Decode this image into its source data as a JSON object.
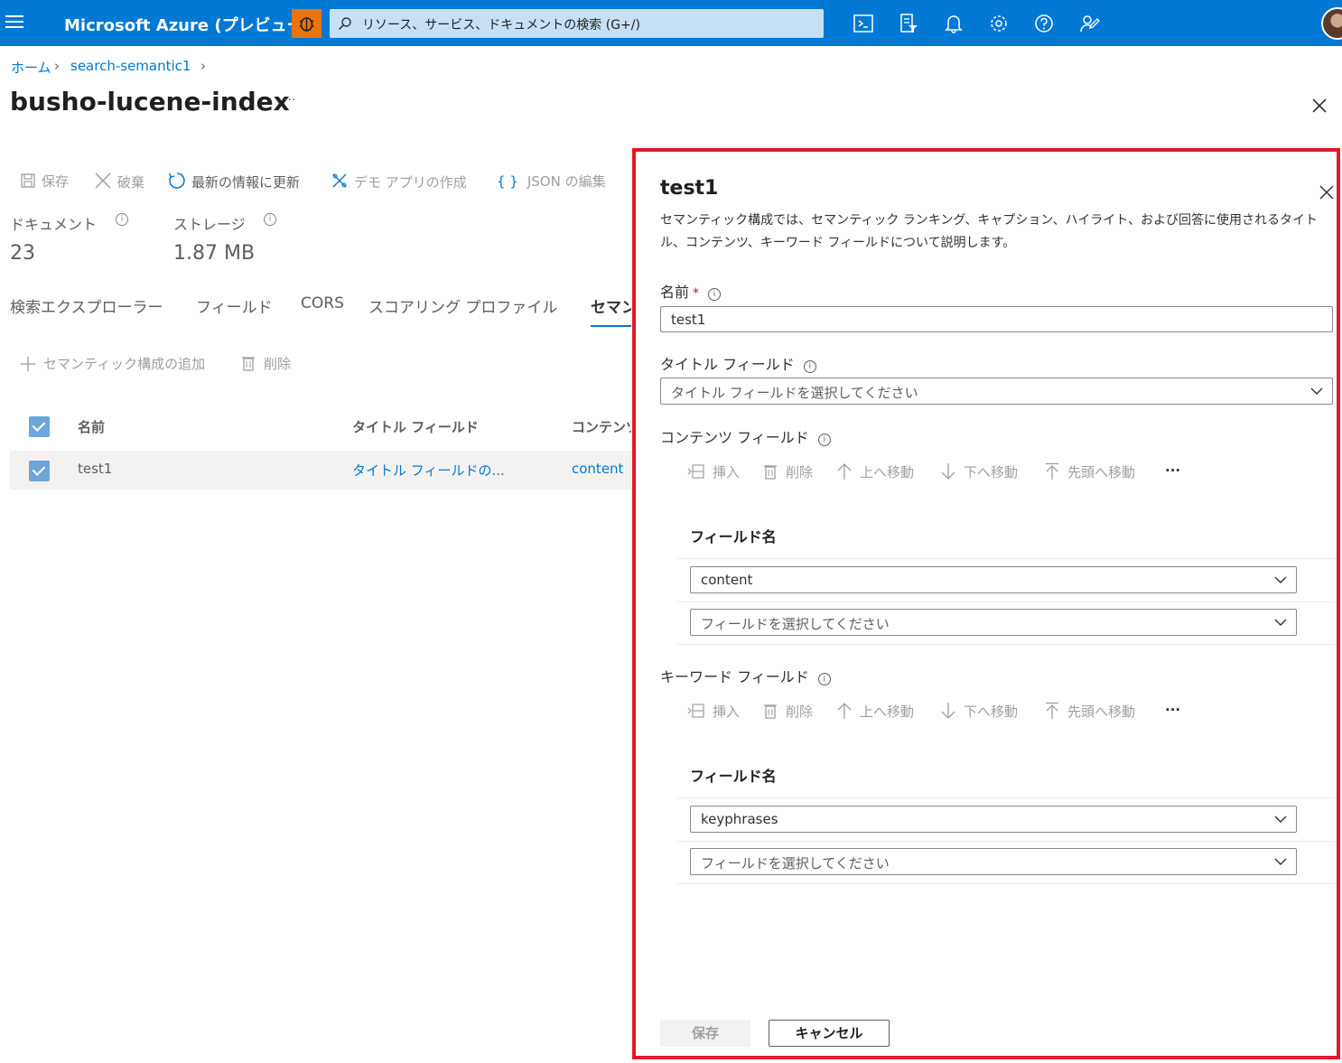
{
  "topbar": {
    "title": "Microsoft Azure (プレビュー)",
    "search_placeholder": "リソース、サービス、ドキュメントの検索 (G+/)",
    "icons": [
      "menu-icon",
      "bug-icon",
      "cloud-shell-icon",
      "directory-filter-icon",
      "bell-icon",
      "gear-icon",
      "help-icon",
      "feedback-icon"
    ]
  },
  "breadcrumb": {
    "home": "ホーム",
    "service": "search-semantic1"
  },
  "page": {
    "title": "busho-lucene-index",
    "more": "···"
  },
  "toolbar": {
    "save": "保存",
    "discard": "破棄",
    "refresh": "最新の情報に更新",
    "demo_app": "デモ アプリの作成",
    "json_edit": "JSON の編集"
  },
  "stats": {
    "documents_label": "ドキュメント",
    "documents_value": "23",
    "storage_label": "ストレージ",
    "storage_value": "1.87 MB"
  },
  "tabs": [
    "検索エクスプローラー",
    "フィールド",
    "CORS",
    "スコアリング プロファイル",
    "セマンティック構成"
  ],
  "semantic_toolbar": {
    "add": "セマンティック構成の追加",
    "delete": "削除"
  },
  "table": {
    "headers": [
      "名前",
      "タイトル フィールド",
      "コンテンツ フィールド"
    ],
    "rows": [
      {
        "name": "test1",
        "title_field": "タイトル フィールドの...",
        "content_field": "content"
      }
    ]
  },
  "panel": {
    "title": "test1",
    "description": "セマンティック構成では、セマンティック ランキング、キャプション、ハイライト、および回答に使用されるタイトル、コンテンツ、キーワード フィールドについて説明します。",
    "name_label": "名前",
    "required_mark": "*",
    "name_value": "test1",
    "title_field_label": "タイトル フィールド",
    "title_field_placeholder": "タイトル フィールドを選択してください",
    "content_fields_label": "コンテンツ フィールド",
    "keyword_fields_label": "キーワード フィールド",
    "grid_commands": {
      "insert": "挿入",
      "delete": "削除",
      "move_up": "上へ移動",
      "move_down": "下へ移動",
      "move_top": "先頭へ移動",
      "more": "···"
    },
    "field_name_header": "フィールド名",
    "content_fields": [
      "content"
    ],
    "keyword_fields": [
      "keyphrases"
    ],
    "field_placeholder": "フィールドを選択してください",
    "save": "保存",
    "cancel": "キャンセル"
  },
  "colors": {
    "azure_blue": "#0078d4",
    "highlight_border": "#e3172e",
    "bug_orange": "#e9730c"
  }
}
